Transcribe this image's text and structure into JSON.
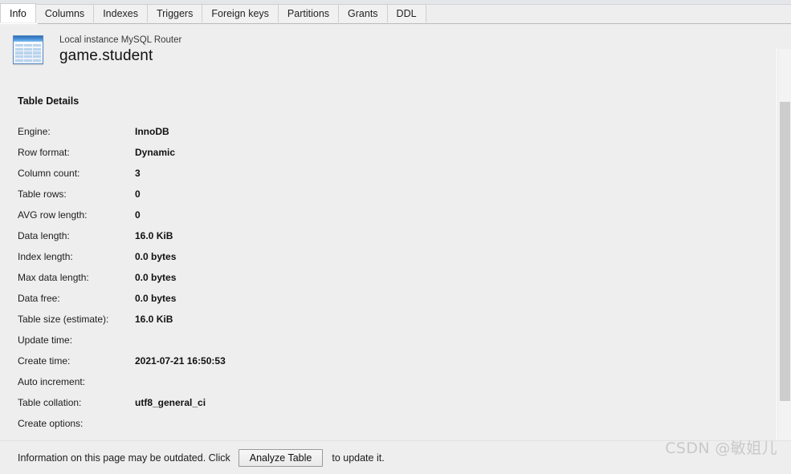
{
  "tabs": [
    {
      "label": "Info",
      "active": true
    },
    {
      "label": "Columns",
      "active": false
    },
    {
      "label": "Indexes",
      "active": false
    },
    {
      "label": "Triggers",
      "active": false
    },
    {
      "label": "Foreign keys",
      "active": false
    },
    {
      "label": "Partitions",
      "active": false
    },
    {
      "label": "Grants",
      "active": false
    },
    {
      "label": "DDL",
      "active": false
    }
  ],
  "header": {
    "icon": "table-icon",
    "subtitle": "Local instance MySQL Router",
    "title": "game.student"
  },
  "details": {
    "heading": "Table Details",
    "rows": [
      {
        "label": "Engine:",
        "value": "InnoDB"
      },
      {
        "label": "Row format:",
        "value": "Dynamic"
      },
      {
        "label": "Column count:",
        "value": "3"
      },
      {
        "label": "Table rows:",
        "value": "0"
      },
      {
        "label": "AVG row length:",
        "value": "0"
      },
      {
        "label": "Data length:",
        "value": "16.0 KiB"
      },
      {
        "label": "Index length:",
        "value": "0.0 bytes"
      },
      {
        "label": "Max data length:",
        "value": "0.0 bytes"
      },
      {
        "label": "Data free:",
        "value": "0.0 bytes"
      },
      {
        "label": "Table size (estimate):",
        "value": "16.0 KiB"
      },
      {
        "label": "Update time:",
        "value": ""
      },
      {
        "label": "Create time:",
        "value": "2021-07-21 16:50:53"
      },
      {
        "label": "Auto increment:",
        "value": ""
      },
      {
        "label": "Table collation:",
        "value": "utf8_general_ci"
      },
      {
        "label": "Create options:",
        "value": ""
      }
    ]
  },
  "statusbar": {
    "text_before": "Information on this page may be outdated. Click",
    "button_label": "Analyze Table",
    "text_after": "to update it."
  },
  "watermark": "CSDN @敏姐儿",
  "colors": {
    "background": "#efeeee",
    "active_tab": "#ffffff",
    "icon_blue": "#4f97dd",
    "scrollbar_thumb": "#cdcdcd",
    "watermark": "#c9c9c9"
  }
}
